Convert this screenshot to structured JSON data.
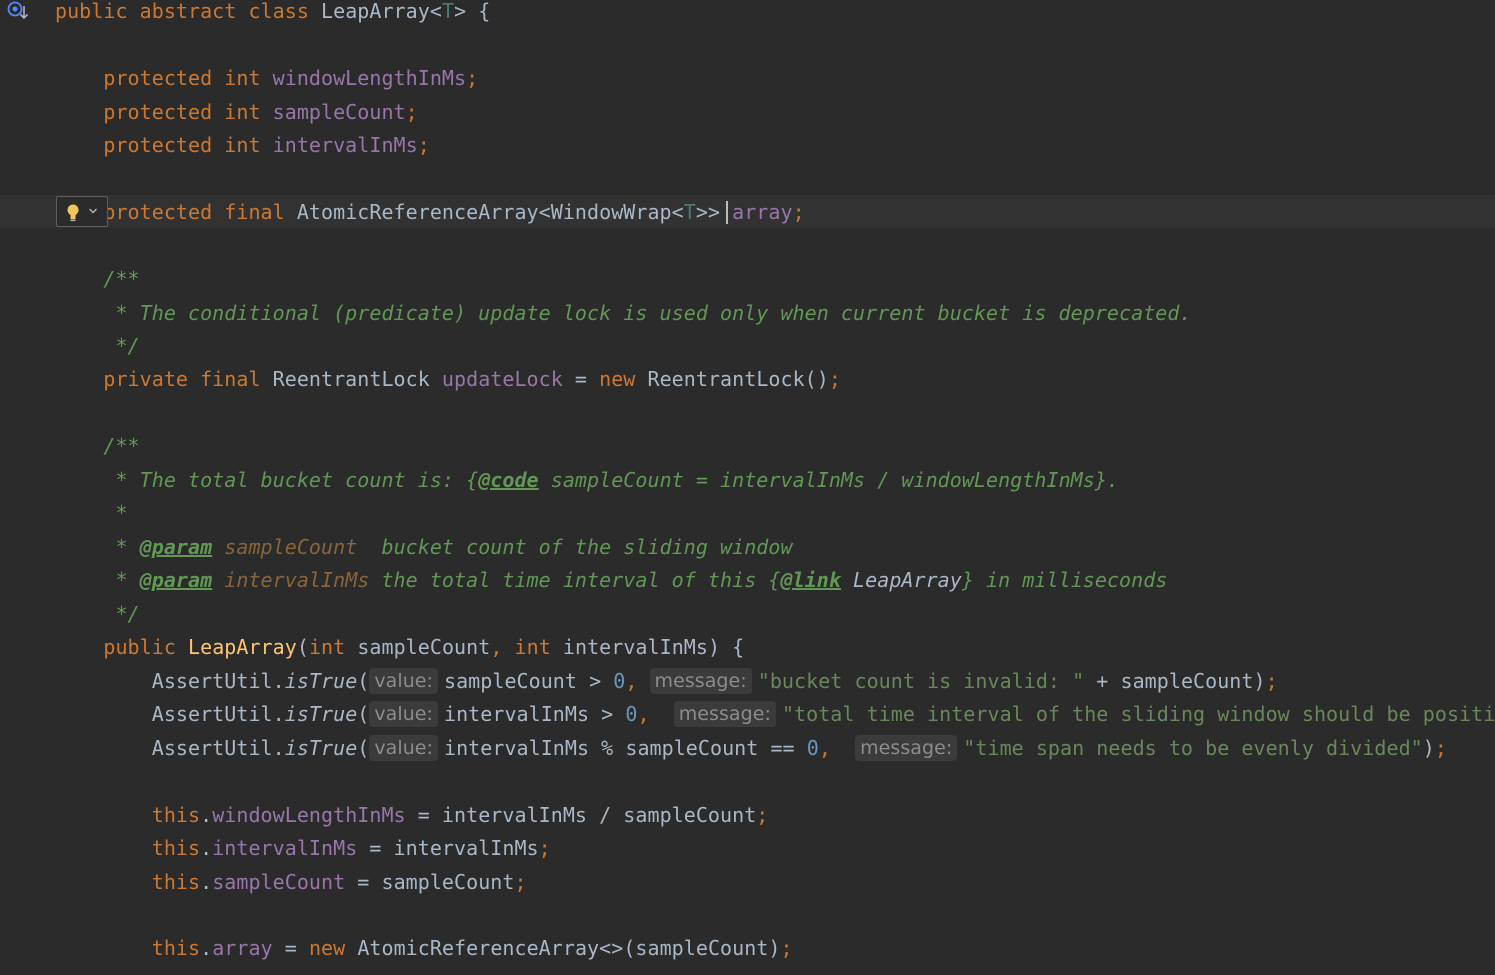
{
  "editor": {
    "gutter_icon": "implementations-icon",
    "caret_line": 4,
    "lines": [
      [
        {
          "t": "public abstract class ",
          "c": "kw"
        },
        {
          "t": "LeapArray",
          "c": "typ"
        },
        {
          "t": "<",
          "c": "typ"
        },
        {
          "t": "T",
          "c": "tparam"
        },
        {
          "t": "> {",
          "c": "typ"
        }
      ],
      [
        {
          "t": "    protected int ",
          "c": "kw"
        },
        {
          "t": "windowLengthInMs",
          "c": "fld"
        },
        {
          "t": ";",
          "c": "kw"
        }
      ],
      [
        {
          "t": "    protected int ",
          "c": "kw"
        },
        {
          "t": "sampleCount",
          "c": "fld"
        },
        {
          "t": ";",
          "c": "kw"
        }
      ],
      [
        {
          "t": "    protected int ",
          "c": "kw"
        },
        {
          "t": "intervalInMs",
          "c": "fld"
        },
        {
          "t": ";",
          "c": "kw"
        }
      ],
      [
        {
          "t": "    protected final ",
          "c": "kw"
        },
        {
          "t": "AtomicReferenceArray<WindowWrap<",
          "c": "typ"
        },
        {
          "t": "T",
          "c": "tparam"
        },
        {
          "t": ">> ",
          "c": "typ"
        },
        {
          "t": "array",
          "c": "fld"
        },
        {
          "t": ";",
          "c": "kw"
        }
      ],
      [
        {
          "t": "    /**",
          "c": "cmt"
        }
      ],
      [
        {
          "t": "     * The conditional (predicate) update lock is used only when current bucket is deprecated.",
          "c": "cmt"
        }
      ],
      [
        {
          "t": "     */",
          "c": "cmt"
        }
      ],
      [
        {
          "t": "    private final ",
          "c": "kw"
        },
        {
          "t": "ReentrantLock ",
          "c": "typ"
        },
        {
          "t": "updateLock",
          "c": "fld"
        },
        {
          "t": " = ",
          "c": "typ"
        },
        {
          "t": "new ",
          "c": "kw"
        },
        {
          "t": "ReentrantLock()",
          "c": "typ"
        },
        {
          "t": ";",
          "c": "kw"
        }
      ],
      [
        {
          "t": "    /**",
          "c": "cmt"
        }
      ],
      [
        {
          "t": "     * The total bucket count is: {",
          "c": "cmt"
        },
        {
          "t": "@code",
          "c": "tag"
        },
        {
          "t": " sampleCount = intervalInMs / windowLengthInMs}.",
          "c": "cmt"
        }
      ],
      [
        {
          "t": "     *",
          "c": "cmt"
        }
      ],
      [
        {
          "t": "     * ",
          "c": "cmt"
        },
        {
          "t": "@param",
          "c": "tag"
        },
        {
          "t": " ",
          "c": "cmt"
        },
        {
          "t": "sampleCount",
          "c": "pname"
        },
        {
          "t": "  bucket count of the sliding window",
          "c": "cmt"
        }
      ],
      [
        {
          "t": "     * ",
          "c": "cmt"
        },
        {
          "t": "@param",
          "c": "tag"
        },
        {
          "t": " ",
          "c": "cmt"
        },
        {
          "t": "intervalInMs",
          "c": "pname"
        },
        {
          "t": " the total time interval of this {",
          "c": "cmt"
        },
        {
          "t": "@link",
          "c": "tag"
        },
        {
          "t": " ",
          "c": "cmt"
        },
        {
          "t": "LeapArray",
          "c": "linkref"
        },
        {
          "t": "} in milliseconds",
          "c": "cmt"
        }
      ],
      [
        {
          "t": "     */",
          "c": "cmt"
        }
      ],
      [
        {
          "t": "    public ",
          "c": "kw"
        },
        {
          "t": "LeapArray",
          "c": "fn"
        },
        {
          "t": "(",
          "c": "typ"
        },
        {
          "t": "int ",
          "c": "kw"
        },
        {
          "t": "sampleCount",
          "c": "typ"
        },
        {
          "t": ", ",
          "c": "kw"
        },
        {
          "t": "int ",
          "c": "kw"
        },
        {
          "t": "intervalInMs) {",
          "c": "typ"
        }
      ],
      [
        {
          "t": "        AssertUtil.",
          "c": "typ"
        },
        {
          "t": "isTrue",
          "c": "static"
        },
        {
          "t": "(",
          "c": "typ"
        },
        {
          "t": "value:",
          "c": "hint"
        },
        {
          "t": "sampleCount > ",
          "c": "typ"
        },
        {
          "t": "0",
          "c": "num"
        },
        {
          "t": ", ",
          "c": "kw"
        },
        {
          "t": "message:",
          "c": "hint"
        },
        {
          "t": "\"bucket count is invalid: \"",
          "c": "str"
        },
        {
          "t": " + sampleCount)",
          "c": "typ"
        },
        {
          "t": ";",
          "c": "kw"
        }
      ],
      [
        {
          "t": "        AssertUtil.",
          "c": "typ"
        },
        {
          "t": "isTrue",
          "c": "static"
        },
        {
          "t": "(",
          "c": "typ"
        },
        {
          "t": "value:",
          "c": "hint"
        },
        {
          "t": "intervalInMs > ",
          "c": "typ"
        },
        {
          "t": "0",
          "c": "num"
        },
        {
          "t": ",  ",
          "c": "kw"
        },
        {
          "t": "message:",
          "c": "hint"
        },
        {
          "t": "\"total time interval of the sliding window should be positive",
          "c": "str"
        }
      ],
      [
        {
          "t": "        AssertUtil.",
          "c": "typ"
        },
        {
          "t": "isTrue",
          "c": "static"
        },
        {
          "t": "(",
          "c": "typ"
        },
        {
          "t": "value:",
          "c": "hint"
        },
        {
          "t": "intervalInMs % sampleCount == ",
          "c": "typ"
        },
        {
          "t": "0",
          "c": "num"
        },
        {
          "t": ",  ",
          "c": "kw"
        },
        {
          "t": "message:",
          "c": "hint"
        },
        {
          "t": "\"time span needs to be evenly divided\"",
          "c": "str"
        },
        {
          "t": ")",
          "c": "typ"
        },
        {
          "t": ";",
          "c": "kw"
        }
      ],
      [
        {
          "t": "        this",
          "c": "kw"
        },
        {
          "t": ".",
          "c": "typ"
        },
        {
          "t": "windowLengthInMs",
          "c": "fld"
        },
        {
          "t": " = intervalInMs / sampleCount",
          "c": "typ"
        },
        {
          "t": ";",
          "c": "kw"
        }
      ],
      [
        {
          "t": "        this",
          "c": "kw"
        },
        {
          "t": ".",
          "c": "typ"
        },
        {
          "t": "intervalInMs",
          "c": "fld"
        },
        {
          "t": " = intervalInMs",
          "c": "typ"
        },
        {
          "t": ";",
          "c": "kw"
        }
      ],
      [
        {
          "t": "        this",
          "c": "kw"
        },
        {
          "t": ".",
          "c": "typ"
        },
        {
          "t": "sampleCount",
          "c": "fld"
        },
        {
          "t": " = sampleCount",
          "c": "typ"
        },
        {
          "t": ";",
          "c": "kw"
        }
      ],
      [
        {
          "t": "        this",
          "c": "kw"
        },
        {
          "t": ".",
          "c": "typ"
        },
        {
          "t": "array",
          "c": "fld"
        },
        {
          "t": " = ",
          "c": "typ"
        },
        {
          "t": "new ",
          "c": "kw"
        },
        {
          "t": "AtomicReferenceArray<>(sampleCount)",
          "c": "typ"
        },
        {
          "t": ";",
          "c": "kw"
        }
      ]
    ]
  }
}
